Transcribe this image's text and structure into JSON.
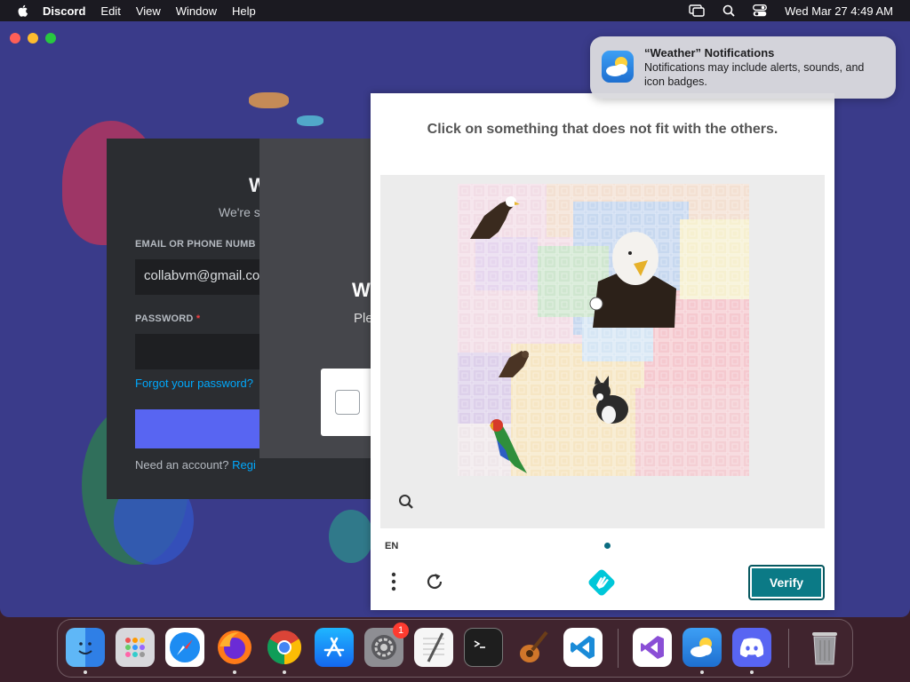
{
  "menubar": {
    "app_name": "Discord",
    "menus": [
      "Edit",
      "View",
      "Window",
      "Help"
    ],
    "clock": "Wed Mar 27  4:49 AM"
  },
  "login": {
    "title": "W",
    "subtitle": "We're s",
    "email_label": "EMAIL OR PHONE NUMB",
    "email_value": "collabvm@gmail.co",
    "password_label": "PASSWORD",
    "required_mark": "*",
    "forgot_link": "Forgot your password?",
    "need_account": "Need an account?",
    "register_link": "Regi"
  },
  "captcha_overlay": {
    "title": "W",
    "subtitle": "Ple"
  },
  "challenge": {
    "prompt": "Click on something that does not fit with the others.",
    "language": "EN",
    "verify_label": "Verify",
    "puzzle_items": [
      "eagle-small-icon",
      "eagle-large-icon",
      "hawk-icon",
      "cat-icon",
      "parrot-icon"
    ]
  },
  "notification": {
    "title": "“Weather” Notifications",
    "body": "Notifications may include alerts, sounds, and icon badges."
  },
  "dock": {
    "items": [
      {
        "name": "finder-icon",
        "running": true
      },
      {
        "name": "launchpad-icon",
        "running": false
      },
      {
        "name": "safari-icon",
        "running": false
      },
      {
        "name": "firefox-icon",
        "running": true
      },
      {
        "name": "chrome-icon",
        "running": true
      },
      {
        "name": "app-store-icon",
        "running": false
      },
      {
        "name": "system-settings-icon",
        "running": false,
        "badge": "1"
      },
      {
        "name": "textedit-icon",
        "running": false
      },
      {
        "name": "terminal-icon",
        "running": false
      },
      {
        "name": "garageband-icon",
        "running": false
      },
      {
        "name": "vscode-icon",
        "running": false
      },
      {
        "name": "visual-studio-icon",
        "running": false
      },
      {
        "name": "weather-icon",
        "running": true
      },
      {
        "name": "discord-icon",
        "running": true
      },
      {
        "name": "trash-icon",
        "running": false
      }
    ]
  },
  "colors": {
    "verify": "#0b7a86",
    "discord_bg": "#3a3b8a",
    "card_bg": "#2b2d31"
  }
}
